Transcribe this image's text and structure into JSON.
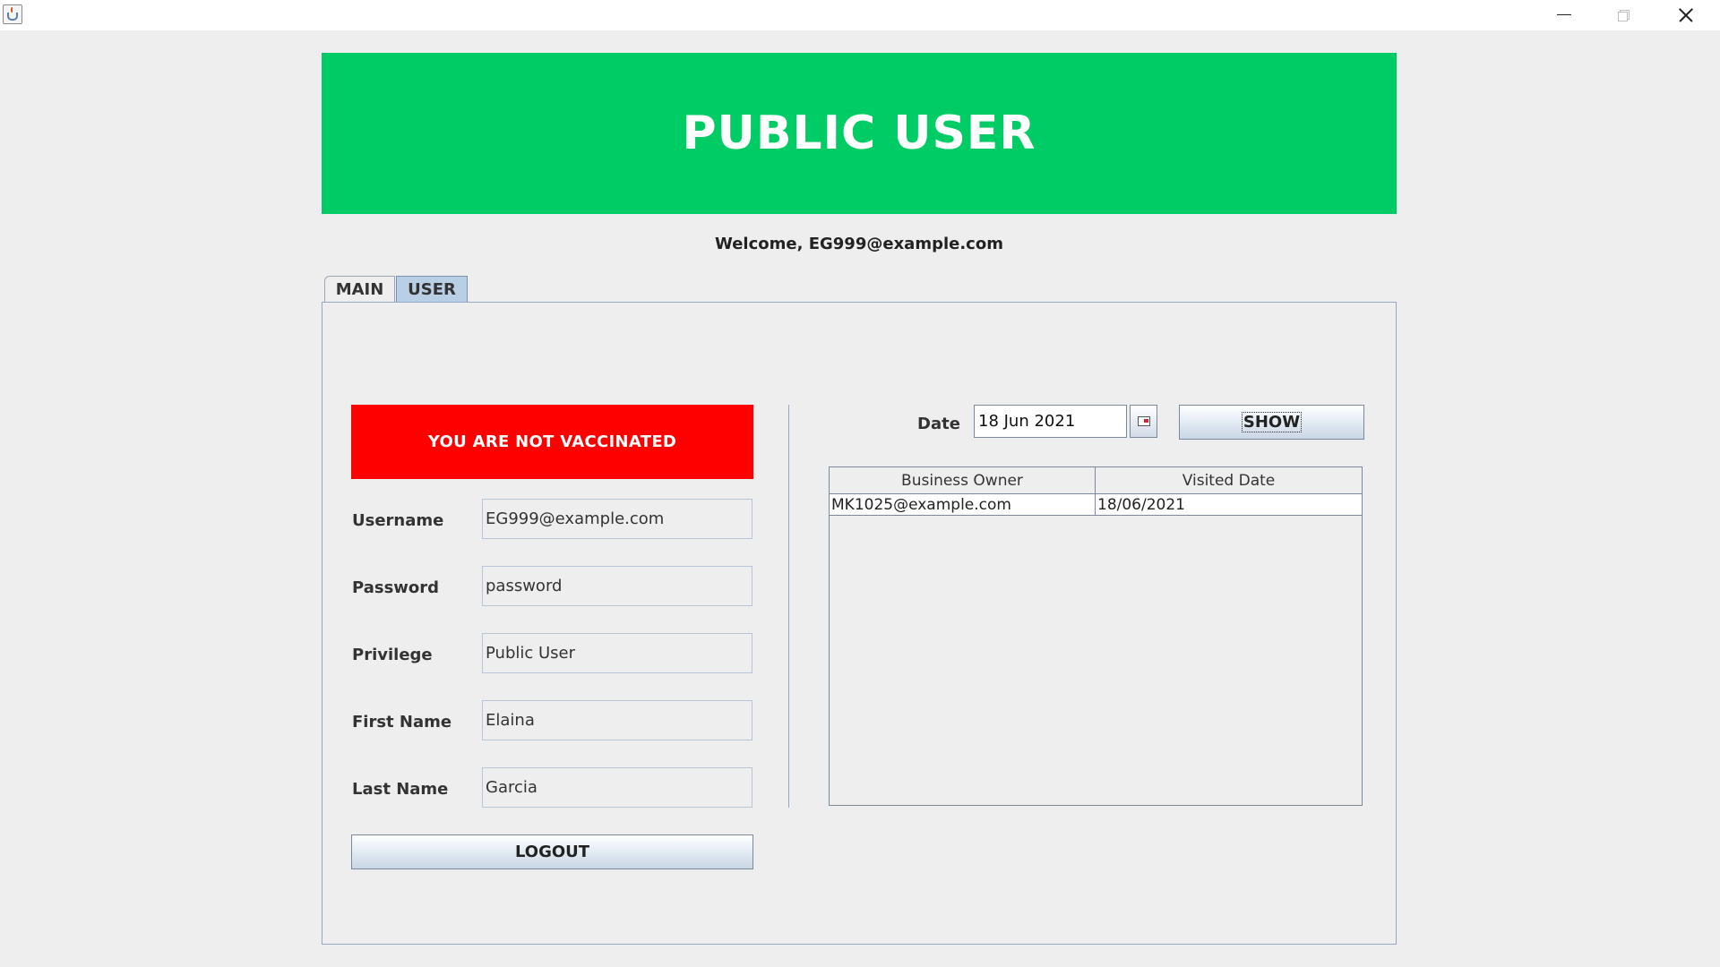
{
  "window": {
    "icon": "java-cup-icon",
    "controls": [
      "minimize-icon",
      "restore-icon",
      "close-icon"
    ]
  },
  "banner": {
    "title": "PUBLIC USER",
    "color": "#00cc66"
  },
  "welcome": "Welcome, EG999@example.com",
  "tabs": [
    {
      "label": "MAIN",
      "selected": false
    },
    {
      "label": "USER",
      "selected": true
    }
  ],
  "status": {
    "text": "YOU ARE NOT VACCINATED",
    "color": "#ff0000"
  },
  "form": {
    "username": {
      "label": "Username",
      "value": "EG999@example.com"
    },
    "password": {
      "label": "Password",
      "value": "password"
    },
    "privilege": {
      "label": "Privilege",
      "value": "Public User"
    },
    "first_name": {
      "label": "First Name",
      "value": "Elaina"
    },
    "last_name": {
      "label": "Last Name",
      "value": "Garcia"
    }
  },
  "logout_label": "LOGOUT",
  "date_filter": {
    "label": "Date",
    "value": "18 Jun 2021",
    "calendar_icon": "calendar-icon",
    "show_label": "SHOW"
  },
  "table": {
    "columns": [
      "Business Owner",
      "Visited Date"
    ],
    "rows": [
      [
        "MK1025@example.com",
        "18/06/2021"
      ]
    ]
  }
}
